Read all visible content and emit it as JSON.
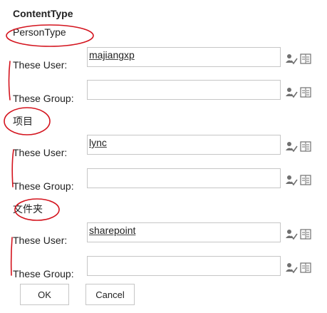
{
  "dialog": {
    "title": "ContentType"
  },
  "sections": [
    {
      "label": "PersonType",
      "user": {
        "label": "These User:",
        "value": "majiangxp"
      },
      "group": {
        "label": "These Group:",
        "value": ""
      }
    },
    {
      "label": "项目",
      "user": {
        "label": "These User:",
        "value": "lync"
      },
      "group": {
        "label": "These Group:",
        "value": ""
      }
    },
    {
      "label": "文件夹",
      "user": {
        "label": "These User:",
        "value": "sharepoint"
      },
      "group": {
        "label": "These Group:",
        "value": ""
      }
    }
  ],
  "buttons": {
    "ok": "OK",
    "cancel": "Cancel"
  },
  "icons": {
    "check_names": "check-names-icon",
    "browse": "address-book-icon"
  },
  "colors": {
    "annotation_red": "#d4141e",
    "border": "#c6c6c6"
  }
}
